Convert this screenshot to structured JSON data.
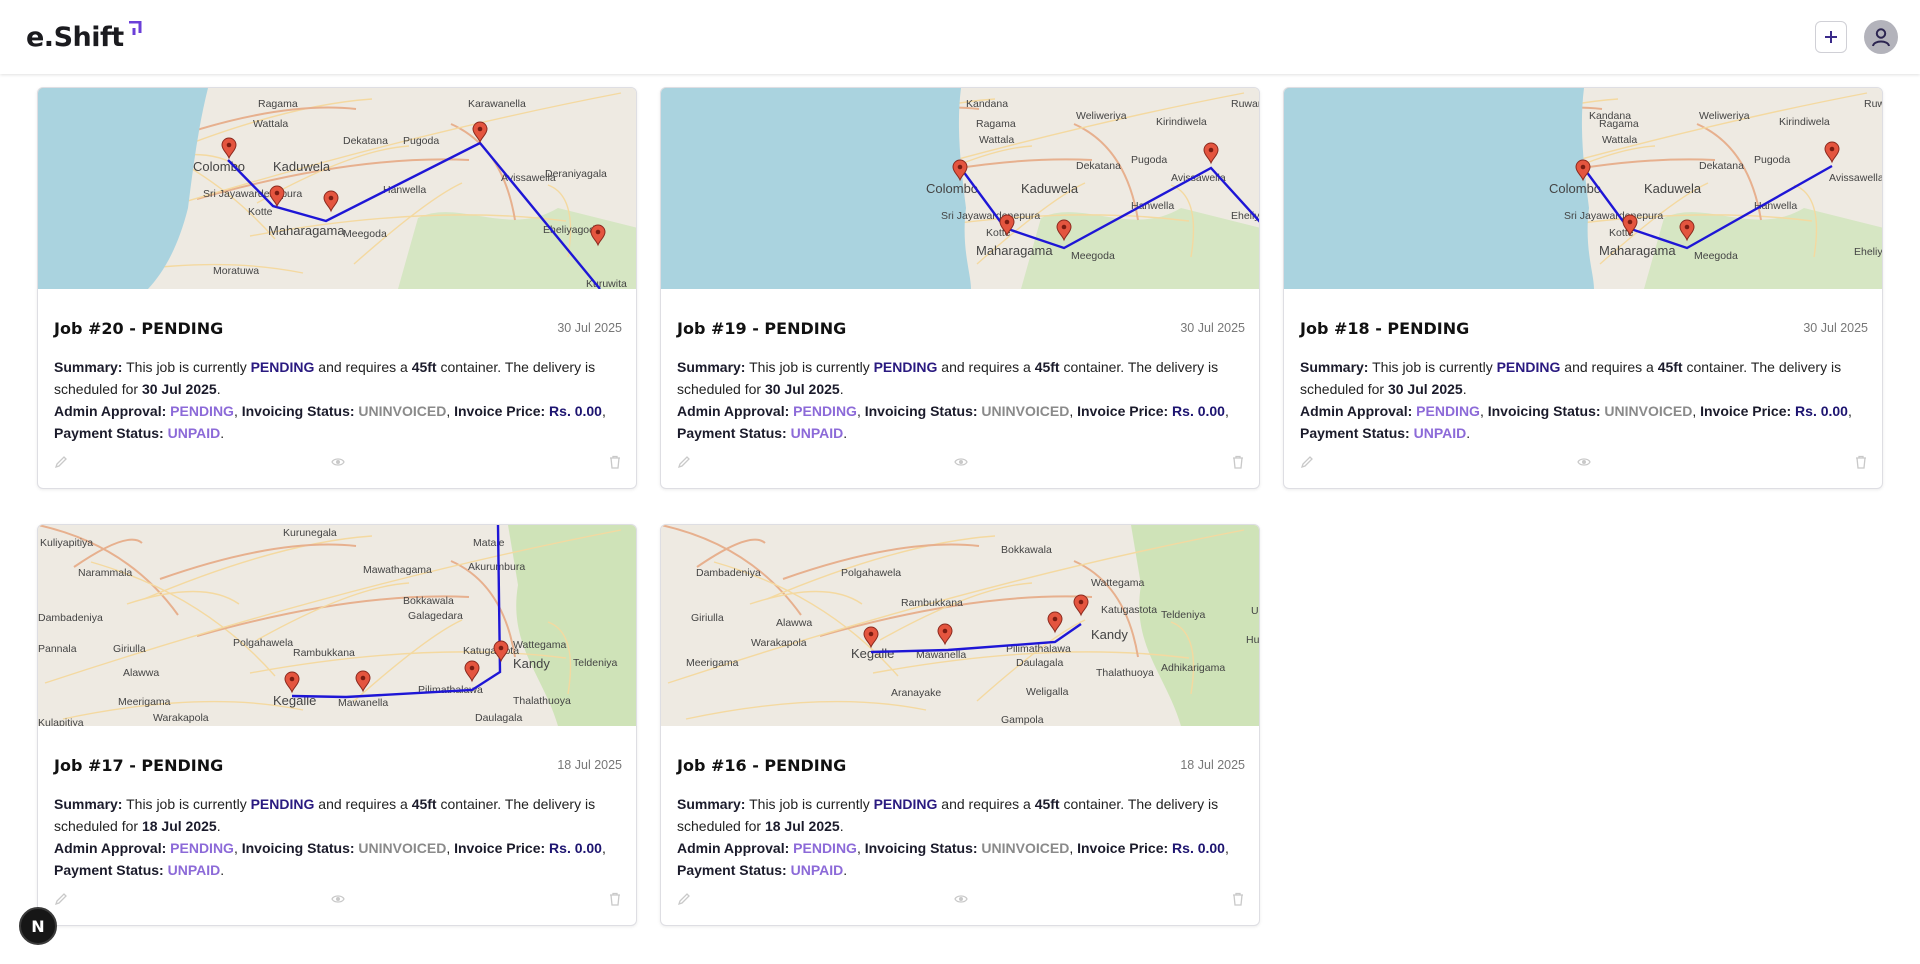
{
  "app": {
    "logo_text": "e.Shift"
  },
  "header": {
    "add_icon": "plus-icon",
    "avatar_icon": "user-icon"
  },
  "labels": {
    "summary": "Summary:",
    "admin_approval": "Admin Approval:",
    "invoicing_status": "Invoicing Status:",
    "invoice_price": "Invoice Price:",
    "payment_status": "Payment Status:",
    "text1": "This job is currently",
    "text2": "and requires a",
    "text3": "container. The delivery is scheduled for"
  },
  "jobs": [
    {
      "title": "Job #20 - PENDING",
      "date": "30 Jul 2025",
      "status": "PENDING",
      "container": "45ft",
      "delivery": "30 Jul 2025",
      "admin_approval": "PENDING",
      "invoicing": "UNINVOICED",
      "price": "Rs. 0.00",
      "payment": "UNPAID",
      "map": {
        "labels": [
          "Ragama",
          "Wattala",
          "Karawanella",
          "Colombo",
          "Kaduwela",
          "Sri Jayawardenepura",
          "Kotte",
          "Maharagama",
          "Meegoda",
          "Hanwella",
          "Dekatana",
          "Pugoda",
          "Avissawella",
          "Deraniyagala",
          "Eheliyagoda",
          "Moratuwa",
          "Kuruwita"
        ]
      }
    },
    {
      "title": "Job #19 - PENDING",
      "date": "30 Jul 2025",
      "status": "PENDING",
      "container": "45ft",
      "delivery": "30 Jul 2025",
      "admin_approval": "PENDING",
      "invoicing": "UNINVOICED",
      "price": "Rs. 0.00",
      "payment": "UNPAID",
      "map": {
        "labels": [
          "Kandana",
          "Weliweriya",
          "Ruwanwe",
          "Ragama",
          "Kirindiwela",
          "Wattala",
          "Dekatana",
          "Pugoda",
          "Colombo",
          "Kaduwela",
          "Avissawella",
          "Hanwella",
          "Sri Jayawardenepura",
          "Kotte",
          "Maharagama",
          "Meegoda",
          "Eheliyag"
        ]
      }
    },
    {
      "title": "Job #18 - PENDING",
      "date": "30 Jul 2025",
      "status": "PENDING",
      "container": "45ft",
      "delivery": "30 Jul 2025",
      "admin_approval": "PENDING",
      "invoicing": "UNINVOICED",
      "price": "Rs. 0.00",
      "payment": "UNPAID",
      "map": {
        "labels": [
          "Ruwanwe",
          "Kandana",
          "Weliweriya",
          "Ragama",
          "Kirindiwela",
          "Wattala",
          "Dekatana",
          "Pugoda",
          "Colombo",
          "Kaduwela",
          "Avissawella",
          "Hanwella",
          "Sri Jayawardenepura",
          "Kotte",
          "Maharagama",
          "Meegoda",
          "Eheliyag"
        ]
      }
    },
    {
      "title": "Job #17 - PENDING",
      "date": "18 Jul 2025",
      "status": "PENDING",
      "container": "45ft",
      "delivery": "18 Jul 2025",
      "admin_approval": "PENDING",
      "invoicing": "UNINVOICED",
      "price": "Rs. 0.00",
      "payment": "UNPAID",
      "map": {
        "labels": [
          "Kuliyapitiya",
          "Kurunegala",
          "Matale",
          "Narammala",
          "Mawathagama",
          "Akurumbura",
          "Dambadeniya",
          "Bokkawala",
          "Galagedara",
          "Polgahawela",
          "Wattegama",
          "Pannala",
          "Giriulla",
          "Rambukkana",
          "Katugastota",
          "Kandy",
          "Alawwa",
          "Kegalle",
          "Mawanella",
          "Pilimathalawa",
          "Teldeniya",
          "Meerigama",
          "Warakapola",
          "Daulagala",
          "Thalathuoya",
          "Kulapitiya"
        ]
      }
    },
    {
      "title": "Job #16 - PENDING",
      "date": "18 Jul 2025",
      "status": "PENDING",
      "container": "45ft",
      "delivery": "18 Jul 2025",
      "admin_approval": "PENDING",
      "invoicing": "UNINVOICED",
      "price": "Rs. 0.00",
      "payment": "UNPAID",
      "map": {
        "labels": [
          "Bokkawala",
          "Dambadeniya",
          "Polgahawela",
          "Rambukkana",
          "Wattegama",
          "Giriulla",
          "Katugastota",
          "Teldeniya",
          "Ududu",
          "Alawwa",
          "Kegalle",
          "Mawanella",
          "Pilimathalawa",
          "Kandy",
          "Hunnasgiri",
          "Meerigama",
          "Warakapola",
          "Daulagala",
          "Thalathuoya",
          "Adhikarigama",
          "Aranayake",
          "Weligalla",
          "Gampola"
        ]
      }
    }
  ],
  "actions": {
    "edit_icon": "pencil-icon",
    "view_icon": "eye-icon",
    "delete_icon": "trash-icon"
  },
  "fab": {
    "label": "N"
  }
}
